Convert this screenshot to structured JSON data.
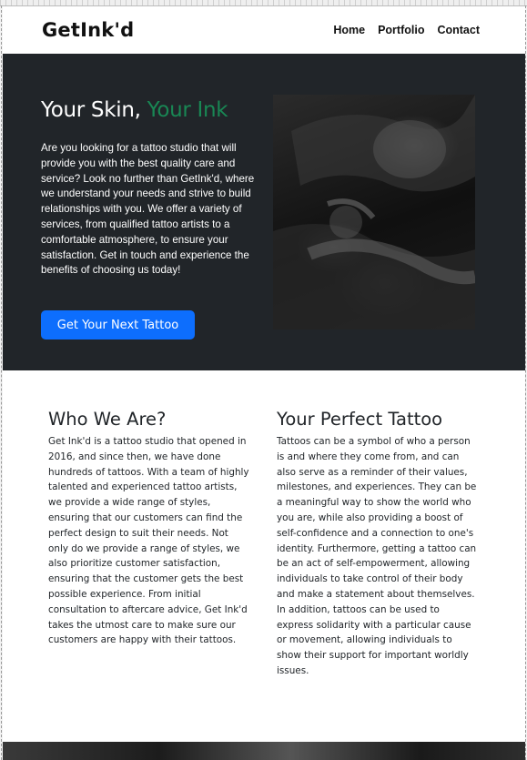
{
  "navbar": {
    "brand": "GetInk'd",
    "links": [
      "Home",
      "Portfolio",
      "Contact"
    ]
  },
  "hero": {
    "title_main": "Your Skin, ",
    "title_accent": "Your Ink",
    "paragraph": "Are you looking for a tattoo studio that will provide you with the best quality care and service? Look no further than GetInk'd, where we understand your needs and strive to build relationships with you. We offer a variety of services, from qualified tattoo artists to a comfortable atmosphere, to ensure your satisfaction. Get in touch and experience the benefits of choosing us today!",
    "cta_label": "Get Your Next Tattoo"
  },
  "about": {
    "who": {
      "title": "Who We Are?",
      "text": "Get Ink'd is a tattoo studio that opened in 2016, and since then, we have done hundreds of tattoos. With a team of highly talented and experienced tattoo artists, we provide a wide range of styles, ensuring that our customers can find the perfect design to suit their needs. Not only do we provide a range of styles, we also prioritize customer satisfaction, ensuring that the customer gets the best possible experience. From initial consultation to aftercare advice, Get Ink'd takes the utmost care to make sure our customers are happy with their tattoos."
    },
    "perfect": {
      "title": "Your Perfect Tattoo",
      "text": "Tattoos can be a symbol of who a person is and where they come from, and can also serve as a reminder of their values, milestones, and experiences. They can be a meaningful way to show the world who you are, while also providing a boost of self-confidence and a connection to one's identity. Furthermore, getting a tattoo can be an act of self-empowerment, allowing individuals to take control of their body and make a statement about themselves. In addition, tattoos can be used to express solidarity with a particular cause or movement, allowing individuals to show their support for important worldly issues."
    }
  },
  "colors": {
    "hero_bg": "#212529",
    "accent_green": "#198754",
    "button_blue": "#0d6efd"
  }
}
